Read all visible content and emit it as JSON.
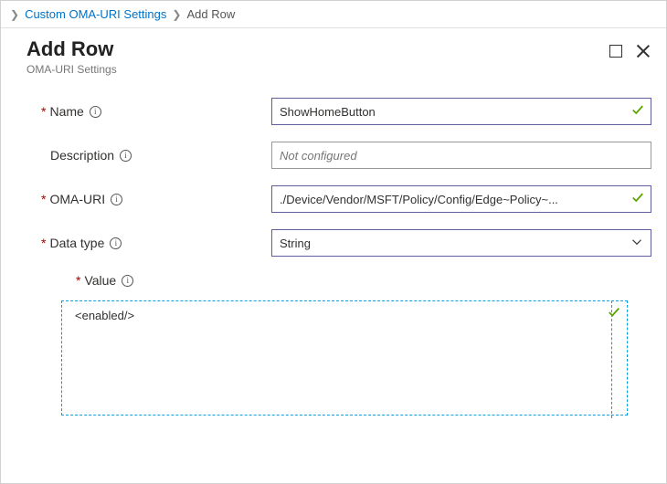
{
  "breadcrumb": {
    "link": "Custom OMA-URI Settings",
    "current": "Add Row"
  },
  "header": {
    "title": "Add Row",
    "subtitle": "OMA-URI Settings"
  },
  "form": {
    "name": {
      "label": "Name",
      "value": "ShowHomeButton"
    },
    "description": {
      "label": "Description",
      "placeholder": "Not configured"
    },
    "oma_uri": {
      "label": "OMA-URI",
      "value": "./Device/Vendor/MSFT/Policy/Config/Edge~Policy~..."
    },
    "data_type": {
      "label": "Data type",
      "selected": "String"
    },
    "value": {
      "label": "Value",
      "text": "<enabled/>"
    }
  },
  "info_glyph": "i"
}
